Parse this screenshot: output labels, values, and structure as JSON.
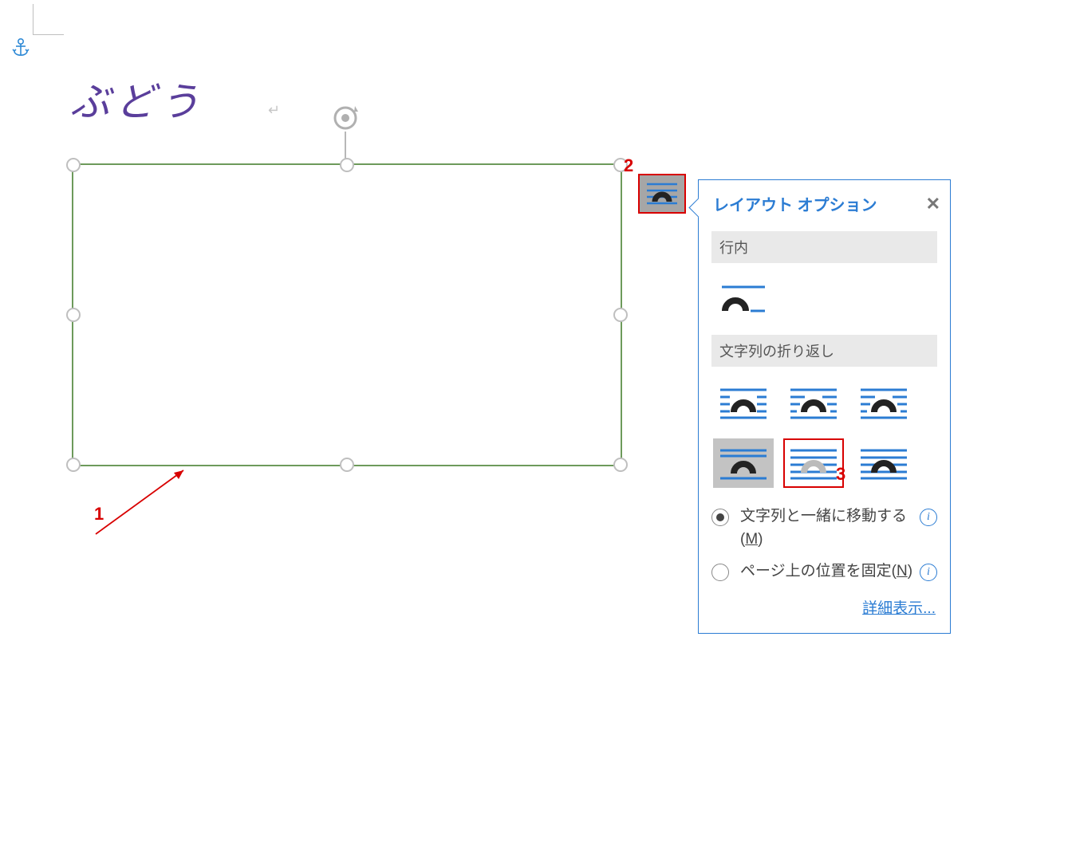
{
  "document": {
    "title_text": "ぶどう",
    "paragraph_mark": "↵"
  },
  "callouts": {
    "n1": "1",
    "n2": "2",
    "n3": "3"
  },
  "panel": {
    "title": "レイアウト オプション",
    "section_inline": "行内",
    "section_wrap": "文字列の折り返し",
    "radio_move_with_text": "文字列と一緒に移動する(",
    "radio_move_key": "M",
    "radio_move_tail": ")",
    "radio_fix_on_page": "ページ上の位置を固定(",
    "radio_fix_key": "N",
    "radio_fix_tail": ")",
    "detail_link": "詳細表示..."
  }
}
